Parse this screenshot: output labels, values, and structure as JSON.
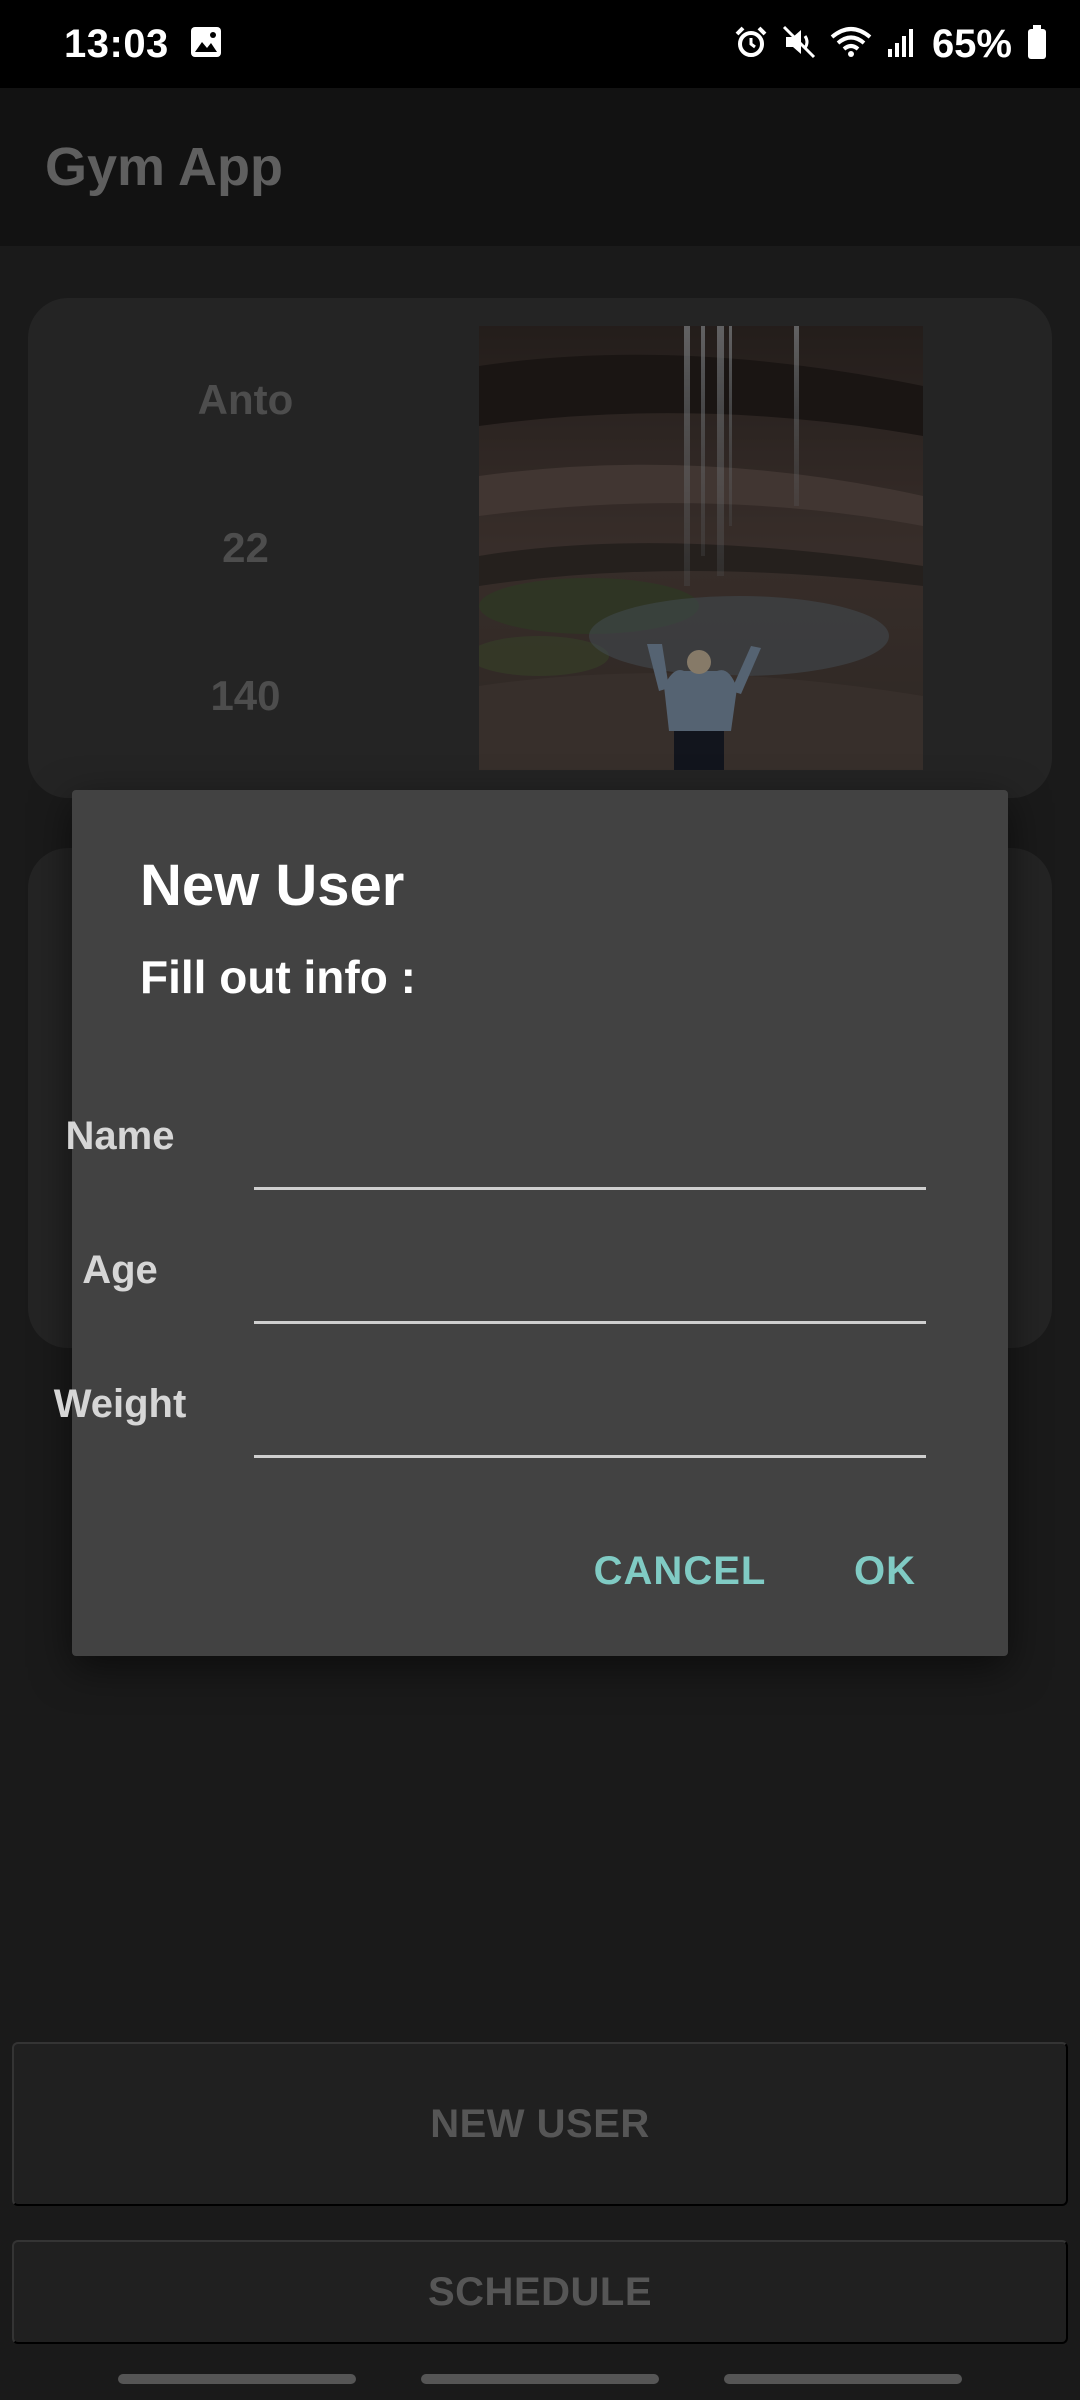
{
  "status_bar": {
    "time": "13:03",
    "battery_percent": "65%",
    "icons": [
      "image-icon",
      "alarm-icon",
      "mute-icon",
      "wifi-icon",
      "signal-icon",
      "battery-icon"
    ]
  },
  "app": {
    "title": "Gym App"
  },
  "profile": {
    "name": "Anto",
    "age": "22",
    "weight": "140"
  },
  "dialog": {
    "title": "New User",
    "subtitle": "Fill out info :",
    "fields": [
      {
        "label": "Name",
        "value": "",
        "placeholder": ""
      },
      {
        "label": "Age",
        "value": "",
        "placeholder": ""
      },
      {
        "label": "Weight",
        "value": "",
        "placeholder": ""
      }
    ],
    "cancel_label": "CANCEL",
    "ok_label": "OK",
    "accent_color": "#80cbc4"
  },
  "buttons": {
    "new_user": "NEW USER",
    "schedule": "SCHEDULE"
  }
}
